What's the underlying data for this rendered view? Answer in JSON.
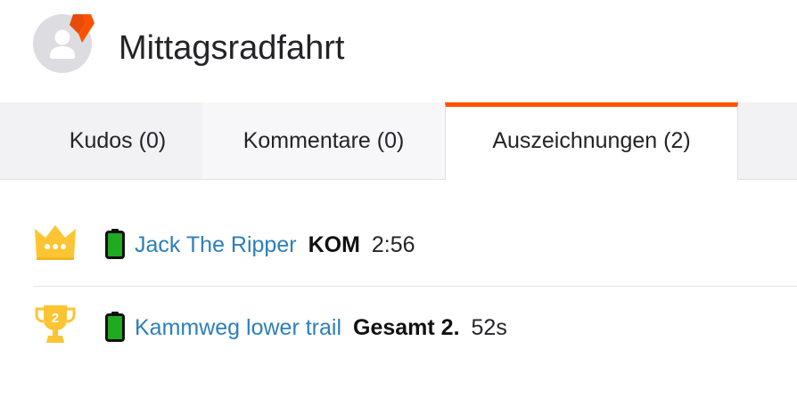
{
  "activity": {
    "title": "Mittagsradfahrt",
    "avatar_icon": "user-silhouette-icon",
    "badge_icon": "strava-subscriber-badge-icon",
    "brand_color": "#fc5200"
  },
  "tabs": [
    {
      "label": "Kudos (0)",
      "active": false
    },
    {
      "label": "Kommentare (0)",
      "active": false
    },
    {
      "label": "Auszeichnungen (2)",
      "active": true
    }
  ],
  "achievements": [
    {
      "icon": "kom-crown-icon",
      "battery_icon": "battery-full-icon",
      "segment": "Jack The Ripper",
      "rank": "KOM",
      "time": "2:56"
    },
    {
      "icon": "trophy-2-icon",
      "trophy_number": "2",
      "battery_icon": "battery-full-icon",
      "segment": "Kammweg lower trail",
      "rank": "Gesamt 2.",
      "time": "52s"
    }
  ]
}
